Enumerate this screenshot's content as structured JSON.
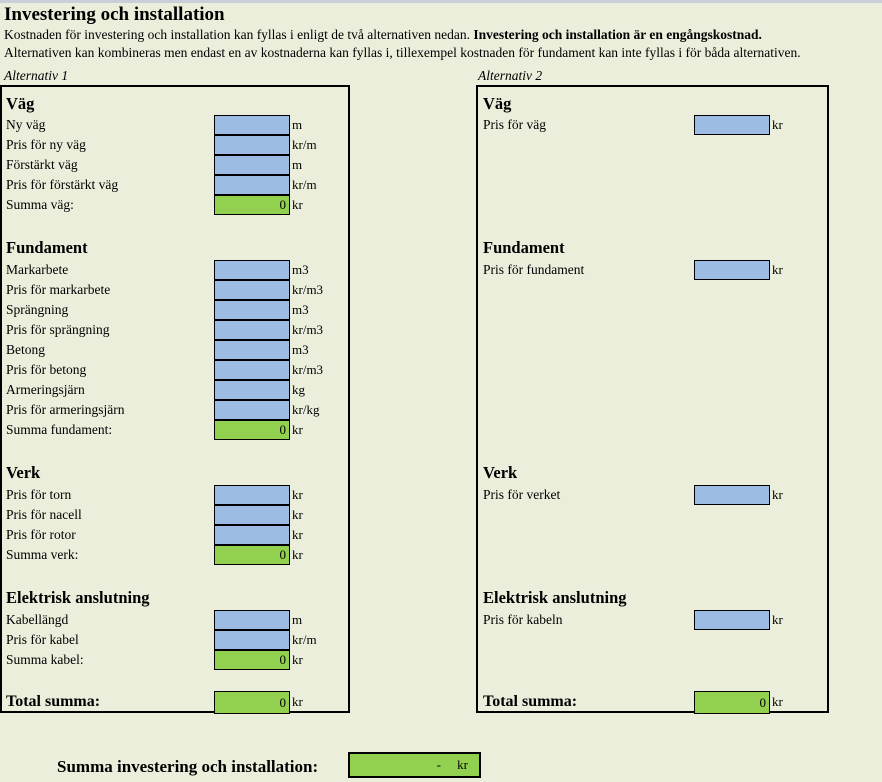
{
  "header": {
    "title": "Investering och installation",
    "intro_1_plain": "Kostnaden för investering och installation kan fyllas i enligt de två alternativen nedan. ",
    "intro_1_bold": "Investering och installation är en engångskostnad.",
    "intro_2": "Alternativen kan kombineras men endast en av kostnaderna kan fyllas i, tillexempel kostnaden för fundament kan inte fyllas i för båda alternativen.",
    "alternativ_1": "Alternativ 1",
    "alternativ_2": "Alternativ 2"
  },
  "alternativ1": {
    "vag": {
      "title": "Väg",
      "rows": [
        {
          "label": "Ny väg",
          "value": "",
          "unit": "m",
          "kind": "input"
        },
        {
          "label": "Pris för ny väg",
          "value": "",
          "unit": "kr/m",
          "kind": "input"
        },
        {
          "label": "Förstärkt väg",
          "value": "",
          "unit": "m",
          "kind": "input"
        },
        {
          "label": "Pris för förstärkt väg",
          "value": "",
          "unit": "kr/m",
          "kind": "input"
        },
        {
          "label": "Summa väg:",
          "value": "0",
          "unit": "kr",
          "kind": "sum"
        }
      ]
    },
    "fundament": {
      "title": "Fundament",
      "rows": [
        {
          "label": "Markarbete",
          "value": "",
          "unit": "m3",
          "kind": "input"
        },
        {
          "label": "Pris för markarbete",
          "value": "",
          "unit": "kr/m3",
          "kind": "input"
        },
        {
          "label": "Sprängning",
          "value": "",
          "unit": "m3",
          "kind": "input"
        },
        {
          "label": "Pris för sprängning",
          "value": "",
          "unit": "kr/m3",
          "kind": "input"
        },
        {
          "label": "Betong",
          "value": "",
          "unit": "m3",
          "kind": "input"
        },
        {
          "label": "Pris för betong",
          "value": "",
          "unit": "kr/m3",
          "kind": "input"
        },
        {
          "label": "Armeringsjärn",
          "value": "",
          "unit": "kg",
          "kind": "input"
        },
        {
          "label": "Pris för armeringsjärn",
          "value": "",
          "unit": "kr/kg",
          "kind": "input"
        },
        {
          "label": "Summa fundament:",
          "value": "0",
          "unit": "kr",
          "kind": "sum"
        }
      ]
    },
    "verk": {
      "title": "Verk",
      "rows": [
        {
          "label": "Pris för torn",
          "value": "",
          "unit": "kr",
          "kind": "input"
        },
        {
          "label": "Pris för nacell",
          "value": "",
          "unit": "kr",
          "kind": "input"
        },
        {
          "label": "Pris för rotor",
          "value": "",
          "unit": "kr",
          "kind": "input"
        },
        {
          "label": "Summa verk:",
          "value": "0",
          "unit": "kr",
          "kind": "sum"
        }
      ]
    },
    "elektrisk": {
      "title": "Elektrisk anslutning",
      "rows": [
        {
          "label": "Kabellängd",
          "value": "",
          "unit": "m",
          "kind": "input"
        },
        {
          "label": "Pris för kabel",
          "value": "",
          "unit": "kr/m",
          "kind": "input"
        },
        {
          "label": "Summa kabel:",
          "value": "0",
          "unit": "kr",
          "kind": "sum"
        }
      ]
    },
    "total": {
      "label": "Total summa:",
      "value": "0",
      "unit": "kr"
    }
  },
  "alternativ2": {
    "vag": {
      "title": "Väg",
      "rows": [
        {
          "label": "Pris för väg",
          "value": "",
          "unit": "kr",
          "kind": "input"
        }
      ]
    },
    "fundament": {
      "title": "Fundament",
      "rows": [
        {
          "label": "Pris för fundament",
          "value": "",
          "unit": "kr",
          "kind": "input"
        }
      ]
    },
    "verk": {
      "title": "Verk",
      "rows": [
        {
          "label": "Pris för verket",
          "value": "",
          "unit": "kr",
          "kind": "input"
        }
      ]
    },
    "elektrisk": {
      "title": "Elektrisk anslutning",
      "rows": [
        {
          "label": "Pris för kabeln",
          "value": "",
          "unit": "kr",
          "kind": "input"
        }
      ]
    },
    "total": {
      "label": "Total summa:",
      "value": "0",
      "unit": "kr"
    }
  },
  "footer": {
    "label": "Summa investering och installation:",
    "value": "-",
    "unit": "kr"
  },
  "colors": {
    "page_background": "#eaeedb",
    "input_cell": "#9cbce4",
    "sum_cell": "#92d050",
    "border": "#000000",
    "top_strip": "#c8cfd8"
  }
}
